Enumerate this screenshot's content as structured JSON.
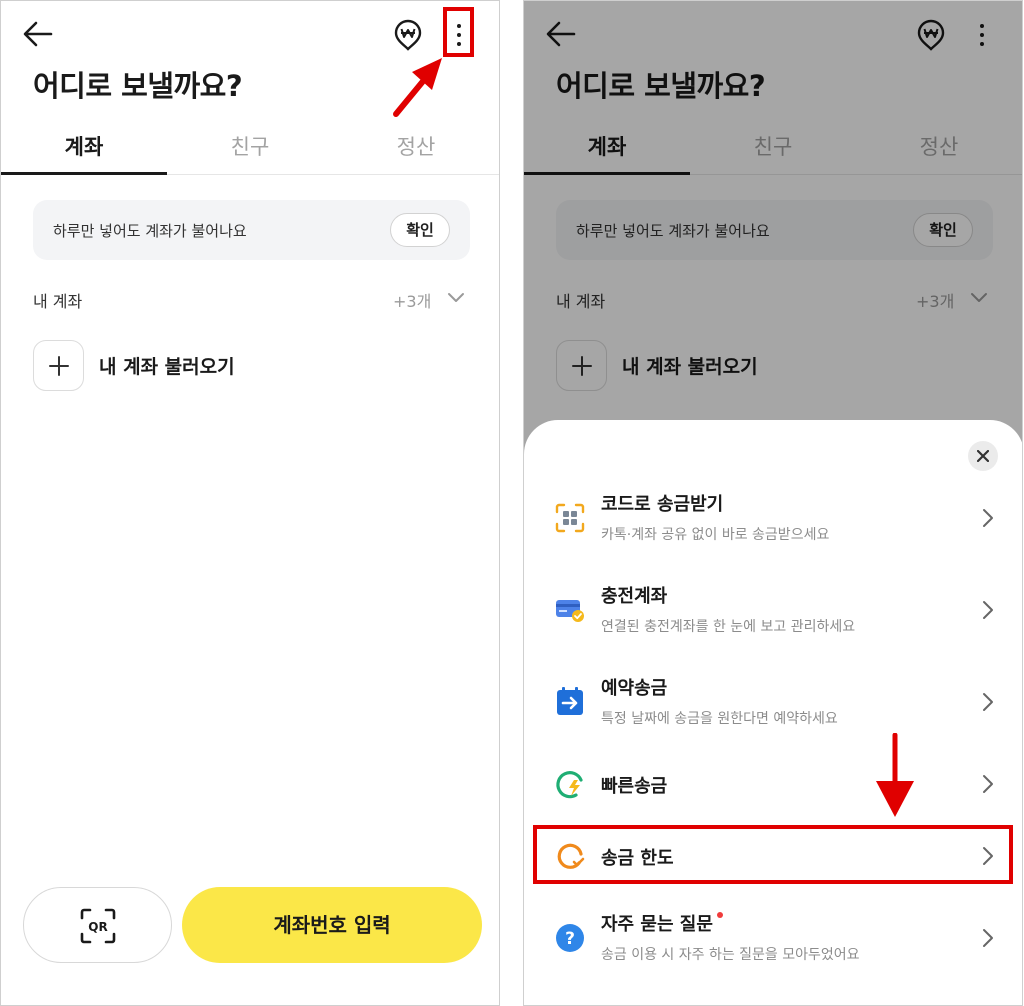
{
  "screen_left": {
    "title": "어디로 보낼까요?",
    "tabs": [
      {
        "label": "계좌",
        "active": true
      },
      {
        "label": "친구",
        "active": false
      },
      {
        "label": "정산",
        "active": false
      }
    ],
    "banner": {
      "text": "하루만 넣어도 계좌가 불어나요",
      "button": "확인"
    },
    "my_accounts": {
      "label": "내 계좌",
      "count": "+3개"
    },
    "add_account": "내 계좌 불러오기",
    "qr_button": "QR",
    "enter_account_button": "계좌번호 입력"
  },
  "screen_right": {
    "title": "어디로 보낼까요?",
    "tabs": [
      {
        "label": "계좌",
        "active": true
      },
      {
        "label": "친구",
        "active": false
      },
      {
        "label": "정산",
        "active": false
      }
    ],
    "banner": {
      "text": "하루만 넣어도 계좌가 불어나요",
      "button": "확인"
    },
    "my_accounts": {
      "label": "내 계좌",
      "count": "+3개"
    },
    "add_account": "내 계좌 불러오기",
    "menu": [
      {
        "title": "코드로 송금받기",
        "subtitle": "카톡·계좌 공유 없이 바로 송금받으세요",
        "icon": "code-scan-icon"
      },
      {
        "title": "충전계좌",
        "subtitle": "연결된 충전계좌를 한 눈에 보고 관리하세요",
        "icon": "card-check-icon"
      },
      {
        "title": "예약송금",
        "subtitle": "특정 날짜에 송금을 원한다면 예약하세요",
        "icon": "calendar-arrow-icon"
      },
      {
        "title": "빠른송금",
        "subtitle": "",
        "icon": "lightning-refresh-icon"
      },
      {
        "title": "송금 한도",
        "subtitle": "",
        "icon": "limit-gauge-icon",
        "highlighted": true
      },
      {
        "title": "자주 묻는 질문",
        "subtitle": "송금 이용 시 자주 하는 질문을 모아두었어요",
        "icon": "question-icon",
        "badge_dot": true
      }
    ]
  },
  "colors": {
    "accent_yellow": "#fbe748",
    "highlight_red": "#e00000",
    "text_primary": "#1a1a1a",
    "text_muted": "#8c8c8c"
  }
}
